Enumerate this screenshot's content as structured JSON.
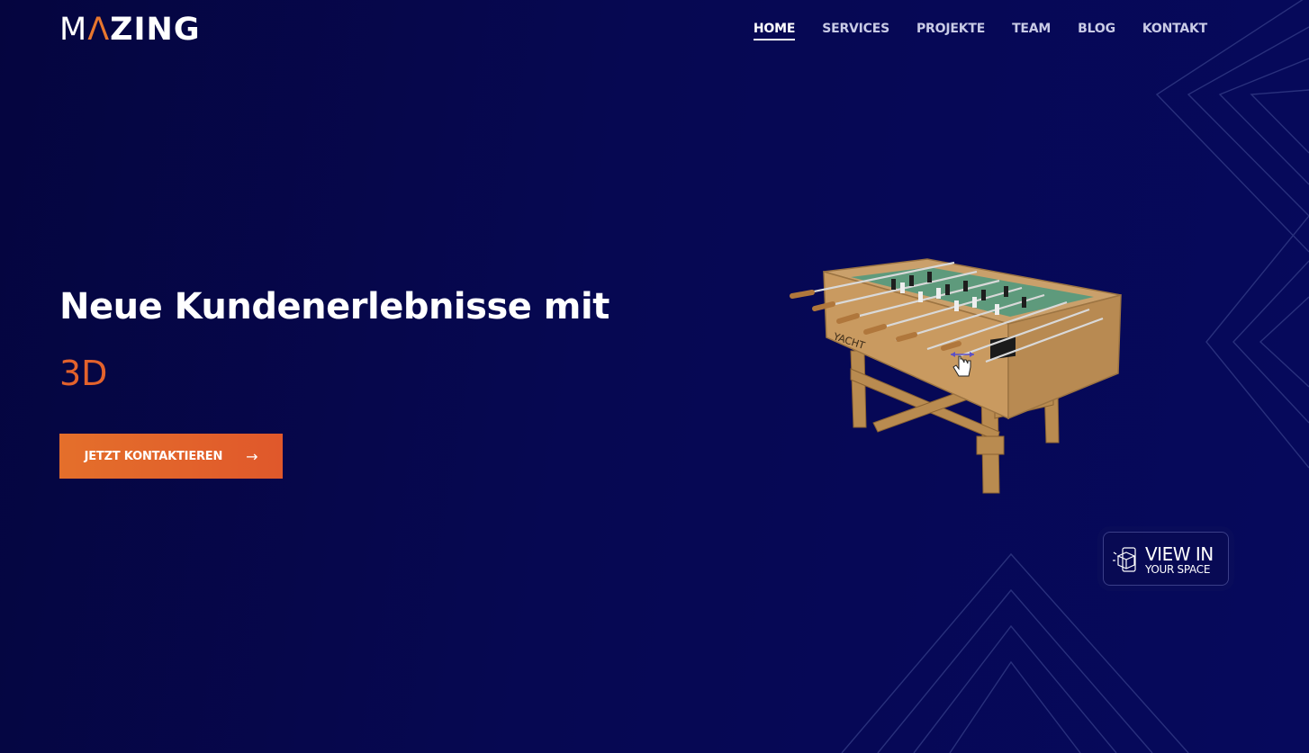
{
  "brand": {
    "logo_part1": "M",
    "logo_accent": "Λ",
    "logo_part2": "ZING"
  },
  "nav": {
    "items": [
      "HOME",
      "SERVICES",
      "PROJEKTE",
      "TEAM",
      "BLOG",
      "KONTAKT"
    ],
    "active": "HOME"
  },
  "hero": {
    "title": "Neue Kundenerlebnisse mit",
    "accent": "3D",
    "cta_label": "JETZT KONTAKTIEREN",
    "cta_icon": "arrow-right-icon"
  },
  "model": {
    "brand_text": "YACHT",
    "drag_hint_icon": "hand-drag-icon"
  },
  "ar_button": {
    "line1": "VIEW IN",
    "line2": "YOUR SPACE",
    "icon": "ar-cube-icon"
  },
  "colors": {
    "background": "#06074f",
    "accent": "#e3622c",
    "cta": "#e46f2b",
    "text": "#ffffff",
    "nav_inactive": "#c9cbe6"
  }
}
